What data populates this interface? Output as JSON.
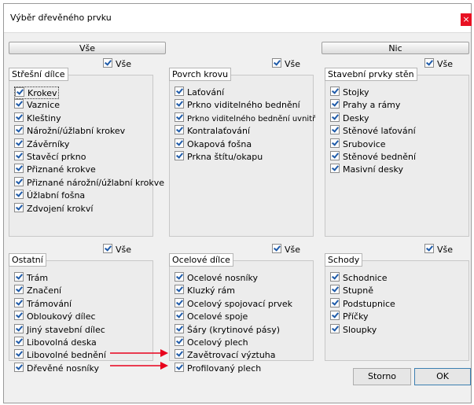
{
  "window": {
    "title": "Výběr dřevěného prvku",
    "close_glyph": "×"
  },
  "header": {
    "all_label": "Vše",
    "none_label": "Nic"
  },
  "all_label": "Vše",
  "panels": {
    "stresni": {
      "title": "Střešní dílce",
      "items": [
        "Krokev",
        "Vaznice",
        "Kleštiny",
        "Nárožní/úžlabní krokev",
        "Závěrníky",
        "Stavěcí prkno",
        "Přiznané krokve",
        "Přiznané nárožní/úžlabní krokve",
        "Úžlabní fošna",
        "Zdvojení krokví"
      ]
    },
    "povrch": {
      "title": "Povrch krovu",
      "items": [
        "Laťování",
        "Prkno viditelného bednění",
        "Prkno viditelného bednění uvnitř",
        "Kontralaťování",
        "Okapová fošna",
        "Prkna štítu/okapu"
      ]
    },
    "stavebni": {
      "title": "Stavební prvky stěn",
      "items": [
        "Stojky",
        "Prahy a rámy",
        "Desky",
        "Stěnové laťování",
        "Srubovice",
        "Stěnové bednění",
        "Masivní desky"
      ]
    },
    "ostatni": {
      "title": "Ostatní",
      "items": [
        "Trám",
        "Značení",
        "Trámování",
        "Obloukový dílec",
        "Jiný stavební dílec",
        "Libovolná deska",
        "Libovolné bednění",
        "Dřevěné nosníky"
      ]
    },
    "ocelove": {
      "title": "Ocelové dílce",
      "items": [
        "Ocelové nosníky",
        "Kluzký rám",
        "Ocelový spojovací prvek",
        "Ocelové spoje",
        "Šáry (krytinové pásy)",
        "Ocelový plech",
        "Zavětrovací výztuha",
        "Profilovaný plech"
      ]
    },
    "schody": {
      "title": "Schody",
      "items": [
        "Schodnice",
        "Stupně",
        "Podstupnice",
        "Příčky",
        "Sloupky"
      ]
    }
  },
  "buttons": {
    "cancel": "Storno",
    "ok": "OK"
  },
  "colors": {
    "arrow": "#e8001c",
    "check": "#1e5aa8",
    "close": "#e81123"
  }
}
